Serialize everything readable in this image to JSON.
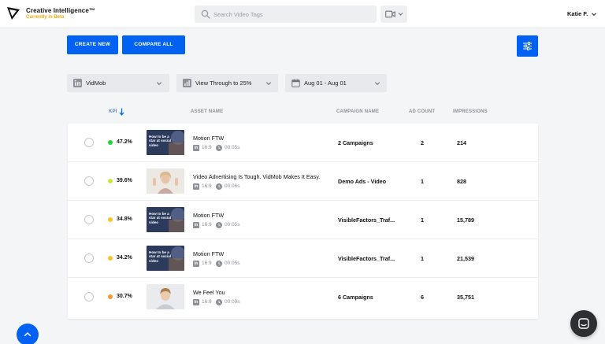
{
  "brand": {
    "title": "Creative Intelligence™",
    "subtitle": "Currently in Beta",
    "subtitle_color": "#f2a900"
  },
  "search": {
    "placeholder": "Search Video Tags",
    "value": "",
    "icon": "search-icon"
  },
  "media_type": {
    "icon": "video-camera-icon"
  },
  "user": {
    "name": "Katie F."
  },
  "toolbar": {
    "create_label": "CREATE NEW",
    "compare_label": "COMPARE ALL",
    "filter_icon": "sliders-icon",
    "accent": "#0061f2"
  },
  "filters": {
    "account": "VidMob",
    "metric": "View Through to 25%",
    "date_range": "Aug 01 - Aug 01"
  },
  "columns": {
    "kpi": "KPI",
    "asset_name": "ASSET NAME",
    "campaign_name": "CAMPAIGN NAME",
    "ad_count": "AD COUNT",
    "impressions": "IMPRESSIONS"
  },
  "rows": [
    {
      "kpi": "47.2%",
      "kpi_color": "#22d33a",
      "thumb_text": "How to be a star at social video",
      "asset": "Motion FTW",
      "platform": "in",
      "ratio": "16:9",
      "duration": "00:05s",
      "campaign": "2 Campaigns",
      "ad_count": "2",
      "impressions": "214"
    },
    {
      "kpi": "39.6%",
      "kpi_color": "#c7e83a",
      "asset": "Video Advertising Is Tough. VidMob Makes It Easy.",
      "platform": "in",
      "ratio": "16:9",
      "duration": "00:06s",
      "campaign": "Demo Ads - Video",
      "ad_count": "1",
      "impressions": "828"
    },
    {
      "kpi": "34.8%",
      "kpi_color": "#f5c62a",
      "thumb_text": "How to be a star at social video",
      "asset": "Motion FTW",
      "platform": "in",
      "ratio": "16:9",
      "duration": "00:05s",
      "campaign": "VisibleFactors_Traf...",
      "ad_count": "1",
      "impressions": "15,789"
    },
    {
      "kpi": "34.2%",
      "kpi_color": "#f5c62a",
      "thumb_text": "How to be a star at social video",
      "asset": "Motion FTW",
      "platform": "in",
      "ratio": "16:9",
      "duration": "00:05s",
      "campaign": "VisibleFactors_Traf...",
      "ad_count": "1",
      "impressions": "21,539"
    },
    {
      "kpi": "30.7%",
      "kpi_color": "#f29a2e",
      "asset": "We Feel You",
      "platform": "in",
      "ratio": "16:9",
      "duration": "00:09s",
      "campaign": "6 Campaigns",
      "ad_count": "6",
      "impressions": "35,751"
    }
  ]
}
